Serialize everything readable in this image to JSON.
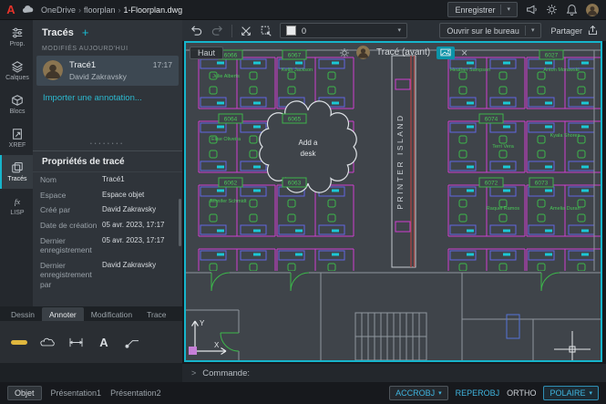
{
  "colors": {
    "accent_teal": "#16b5cc",
    "cad_magenta": "#cf3ed0",
    "cad_green": "#3cb84b",
    "cad_cyan": "#1bc8d6",
    "cad_purple": "#6066e2",
    "logo_red": "#e5332a"
  },
  "top_bar": {
    "logo": "A",
    "breadcrumb": [
      "OneDrive",
      "floorplan",
      "1-Floorplan.dwg"
    ],
    "save_label": "Enregistrer"
  },
  "toolbar": {
    "layer_value": "0",
    "open_desktop_label": "Ouvrir sur le bureau",
    "share_label": "Partager"
  },
  "nav_rail": {
    "items": [
      {
        "label": "Prop."
      },
      {
        "label": "Calques"
      },
      {
        "label": "Blocs"
      },
      {
        "label": "XREF"
      },
      {
        "label": "Tracés",
        "active": true
      },
      {
        "label": "LISP"
      }
    ]
  },
  "traces_panel": {
    "title": "Tracés",
    "section": "MODIFIÉS AUJOURD'HUI",
    "trace_item": {
      "name": "Tracé1",
      "author": "David Zakravsky",
      "time": "17:17"
    },
    "import_link": "Importer une annotation...",
    "properties_title": "Propriétés de tracé",
    "properties": [
      {
        "label": "Nom",
        "value": "Tracé1"
      },
      {
        "label": "Espace",
        "value": "Espace objet"
      },
      {
        "label": "Créé par",
        "value": "David Zakravsky"
      },
      {
        "label": "Date de création",
        "value": "05 avr. 2023, 17:17"
      },
      {
        "label": "Dernier enregistrement",
        "value": "05 avr. 2023, 17:17"
      },
      {
        "label": "Dernier enregistrement par",
        "value": "David Zakravsky"
      }
    ]
  },
  "bottom_tabs": [
    {
      "label": "Dessin"
    },
    {
      "label": "Annoter",
      "active": true
    },
    {
      "label": "Modification"
    },
    {
      "label": "Trace"
    }
  ],
  "canvas": {
    "view_label": "Haut",
    "trace_label": "Tracé (avant)",
    "cloud_line1": "Add  a",
    "cloud_line2": "desk",
    "printer_label": "PRINTER ISLAND",
    "ucs_y": "Y",
    "ucs_x": "X",
    "rooms": [
      {
        "number": "6066"
      },
      {
        "number": "6067"
      },
      {
        "number": "6064"
      },
      {
        "number": "6065"
      },
      {
        "number": "6062"
      },
      {
        "number": "6063"
      },
      {
        "number": "6027"
      },
      {
        "number": "6074"
      },
      {
        "number": "6072"
      },
      {
        "number": "6073"
      }
    ],
    "occupants": [
      {
        "name": "Julie Alberts"
      },
      {
        "name": "Keith Jackson"
      },
      {
        "name": "Elise Oliveira"
      },
      {
        "name": "Jennifer Schmidt"
      },
      {
        "name": "Heather Sampson"
      },
      {
        "name": "Anton Morawski"
      },
      {
        "name": "Terri Vera"
      },
      {
        "name": "Kyala Shores"
      },
      {
        "name": "Raquel Ramos"
      },
      {
        "name": "Amelia Duran"
      }
    ]
  },
  "command_bar": {
    "prompt": "Commande:"
  },
  "status_bar": {
    "model_label": "Objet",
    "layouts": [
      {
        "label": "Présentation1"
      },
      {
        "label": "Présentation2"
      }
    ],
    "toggles": [
      {
        "label": "ACCROBJ"
      },
      {
        "label": "REPEROBJ"
      },
      {
        "label": "ORTHO"
      },
      {
        "label": "POLAIRE"
      }
    ]
  }
}
